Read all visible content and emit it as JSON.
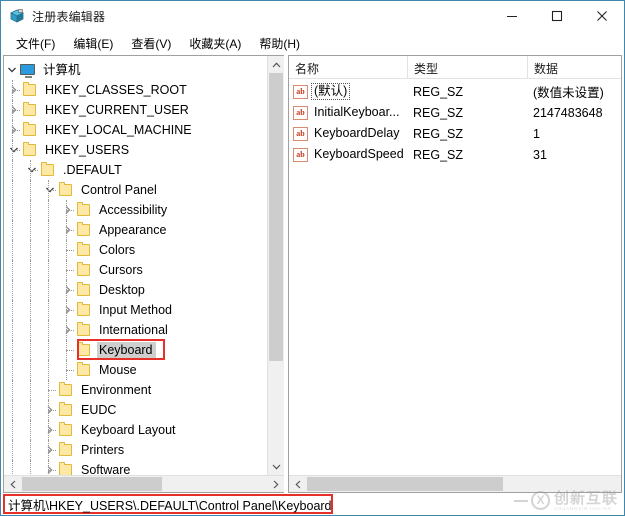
{
  "window": {
    "title": "注册表编辑器",
    "icon": "regedit-icon",
    "border_color": "#3e88b0",
    "caption": {
      "minimize": "minimize-icon",
      "maximize": "maximize-icon",
      "close": "close-icon"
    }
  },
  "menubar": {
    "items": [
      {
        "label": "文件(F)"
      },
      {
        "label": "编辑(E)"
      },
      {
        "label": "查看(V)"
      },
      {
        "label": "收藏夹(A)"
      },
      {
        "label": "帮助(H)"
      }
    ]
  },
  "tree": {
    "nodes": [
      {
        "label": "计算机",
        "depth": 0,
        "expander": "expanded",
        "icon": "computer-icon",
        "selected": false
      },
      {
        "label": "HKEY_CLASSES_ROOT",
        "depth": 1,
        "expander": "collapsed",
        "icon": "folder-icon",
        "selected": false
      },
      {
        "label": "HKEY_CURRENT_USER",
        "depth": 1,
        "expander": "collapsed",
        "icon": "folder-icon",
        "selected": false
      },
      {
        "label": "HKEY_LOCAL_MACHINE",
        "depth": 1,
        "expander": "collapsed",
        "icon": "folder-icon",
        "selected": false
      },
      {
        "label": "HKEY_USERS",
        "depth": 1,
        "expander": "expanded",
        "icon": "folder-icon",
        "selected": false
      },
      {
        "label": ".DEFAULT",
        "depth": 2,
        "expander": "expanded",
        "icon": "folder-icon",
        "selected": false
      },
      {
        "label": "Control Panel",
        "depth": 3,
        "expander": "expanded",
        "icon": "folder-icon",
        "selected": false
      },
      {
        "label": "Accessibility",
        "depth": 4,
        "expander": "collapsed",
        "icon": "folder-icon",
        "selected": false
      },
      {
        "label": "Appearance",
        "depth": 4,
        "expander": "collapsed",
        "icon": "folder-icon",
        "selected": false
      },
      {
        "label": "Colors",
        "depth": 4,
        "expander": "none",
        "icon": "folder-icon",
        "selected": false
      },
      {
        "label": "Cursors",
        "depth": 4,
        "expander": "none",
        "icon": "folder-icon",
        "selected": false
      },
      {
        "label": "Desktop",
        "depth": 4,
        "expander": "collapsed",
        "icon": "folder-icon",
        "selected": false
      },
      {
        "label": "Input Method",
        "depth": 4,
        "expander": "collapsed",
        "icon": "folder-icon",
        "selected": false
      },
      {
        "label": "International",
        "depth": 4,
        "expander": "collapsed",
        "icon": "folder-icon",
        "selected": false
      },
      {
        "label": "Keyboard",
        "depth": 4,
        "expander": "none",
        "icon": "folder-icon",
        "selected": true
      },
      {
        "label": "Mouse",
        "depth": 4,
        "expander": "none",
        "icon": "folder-icon",
        "selected": false
      },
      {
        "label": "Environment",
        "depth": 3,
        "expander": "none",
        "icon": "folder-icon",
        "selected": false
      },
      {
        "label": "EUDC",
        "depth": 3,
        "expander": "collapsed",
        "icon": "folder-icon",
        "selected": false
      },
      {
        "label": "Keyboard Layout",
        "depth": 3,
        "expander": "collapsed",
        "icon": "folder-icon",
        "selected": false
      },
      {
        "label": "Printers",
        "depth": 3,
        "expander": "collapsed",
        "icon": "folder-icon",
        "selected": false
      },
      {
        "label": "Software",
        "depth": 3,
        "expander": "collapsed",
        "icon": "folder-icon",
        "selected": false
      }
    ],
    "annotation_color": "#e8302a",
    "annotated_label": "Keyboard"
  },
  "list": {
    "columns": [
      {
        "label": "名称"
      },
      {
        "label": "类型"
      },
      {
        "label": "数据"
      }
    ],
    "rows": [
      {
        "name": "(默认)",
        "type": "REG_SZ",
        "data": "(数值未设置)",
        "icon": "string-value-icon",
        "focused": true
      },
      {
        "name": "InitialKeyboar...",
        "type": "REG_SZ",
        "data": "2147483648",
        "icon": "string-value-icon",
        "focused": false
      },
      {
        "name": "KeyboardDelay",
        "type": "REG_SZ",
        "data": "1",
        "icon": "string-value-icon",
        "focused": false
      },
      {
        "name": "KeyboardSpeed",
        "type": "REG_SZ",
        "data": "31",
        "icon": "string-value-icon",
        "focused": false
      }
    ],
    "value_icon_text": "ab"
  },
  "statusbar": {
    "path": "计算机\\HKEY_USERS\\.DEFAULT\\Control Panel\\Keyboard",
    "annotation_color": "#e8302a"
  },
  "watermark": {
    "mark": "X",
    "cn": "创新互联",
    "en": "CHUANGXIN HULIAN"
  }
}
